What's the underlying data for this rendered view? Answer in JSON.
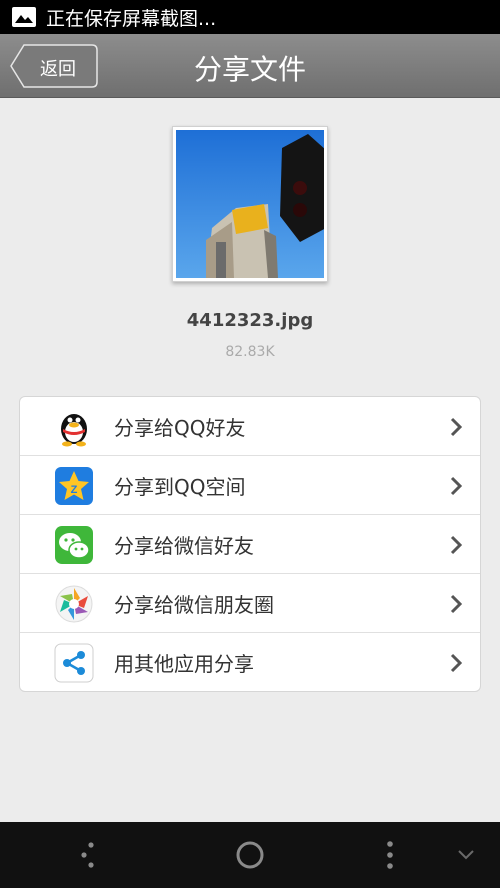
{
  "status_bar": {
    "notification_text": "正在保存屏幕截图..."
  },
  "title_bar": {
    "back_label": "返回",
    "title": "分享文件"
  },
  "file": {
    "name": "4412323.jpg",
    "size": "82.83K"
  },
  "share_options": [
    {
      "label": "分享给QQ好友",
      "icon": "qq-penguin-icon"
    },
    {
      "label": "分享到QQ空间",
      "icon": "qzone-icon"
    },
    {
      "label": "分享给微信好友",
      "icon": "wechat-icon"
    },
    {
      "label": "分享给微信朋友圈",
      "icon": "wechat-moments-icon"
    },
    {
      "label": "用其他应用分享",
      "icon": "share-icon"
    }
  ],
  "colors": {
    "title_bar": "#7d7d7d",
    "background": "#ececec",
    "nav_bar": "#111111"
  }
}
